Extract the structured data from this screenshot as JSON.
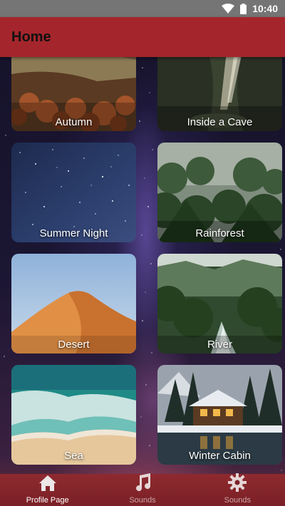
{
  "status_bar": {
    "time": "10:40",
    "wifi_icon": "wifi-icon",
    "battery_icon": "battery-icon"
  },
  "app_bar": {
    "title": "Home",
    "color": "#a4262c"
  },
  "sounds": [
    {
      "label": "Autumn",
      "scene": "autumn"
    },
    {
      "label": "Inside a Cave",
      "scene": "cave"
    },
    {
      "label": "Summer Night",
      "scene": "night"
    },
    {
      "label": "Rainforest",
      "scene": "rainforest"
    },
    {
      "label": "Desert",
      "scene": "desert"
    },
    {
      "label": "River",
      "scene": "river"
    },
    {
      "label": "Sea",
      "scene": "sea"
    },
    {
      "label": "Winter Cabin",
      "scene": "cabin"
    }
  ],
  "bottom_nav": {
    "items": [
      {
        "label": "Profile Page",
        "icon": "home-icon",
        "active": true
      },
      {
        "label": "Sounds",
        "icon": "music-note-icon",
        "active": false
      },
      {
        "label": "Sounds",
        "icon": "gear-icon",
        "active": false
      }
    ]
  }
}
